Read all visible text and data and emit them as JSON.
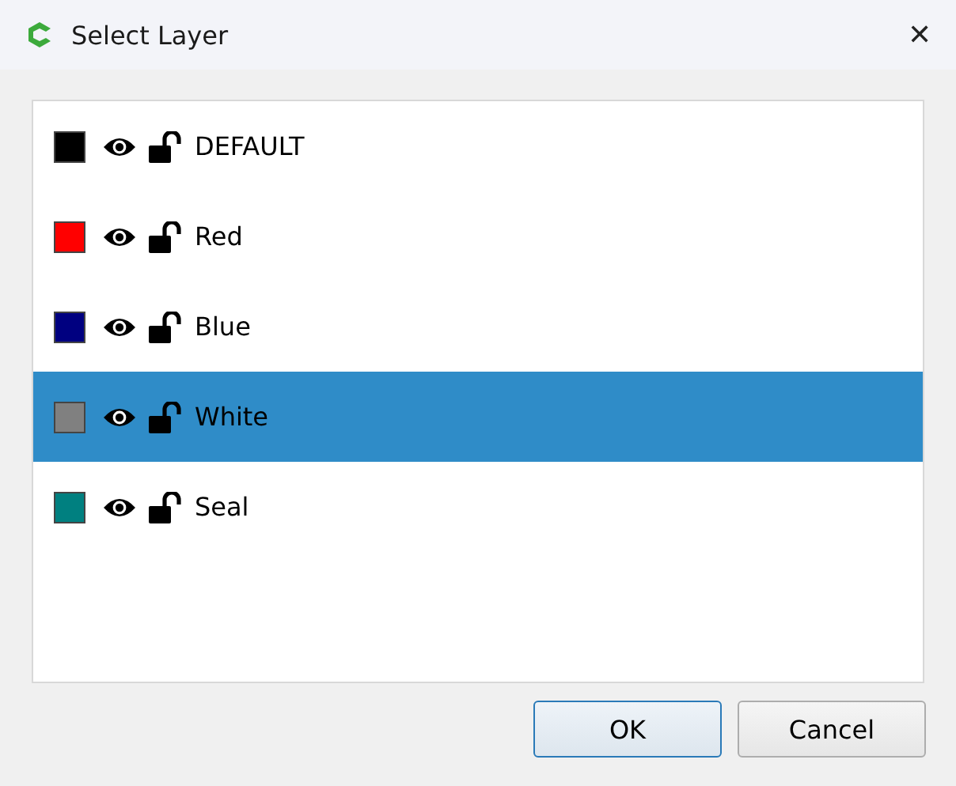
{
  "window": {
    "title": "Select Layer",
    "close": "✕"
  },
  "layers": [
    {
      "name": "DEFAULT",
      "color": "#000000",
      "selected": false
    },
    {
      "name": "Red",
      "color": "#ff0000",
      "selected": false
    },
    {
      "name": "Blue",
      "color": "#000080",
      "selected": false
    },
    {
      "name": "White",
      "color": "#808080",
      "selected": true
    },
    {
      "name": "Seal",
      "color": "#008080",
      "selected": false
    }
  ],
  "buttons": [
    {
      "label": "OK",
      "default": true
    },
    {
      "label": "Cancel",
      "default": false
    }
  ]
}
